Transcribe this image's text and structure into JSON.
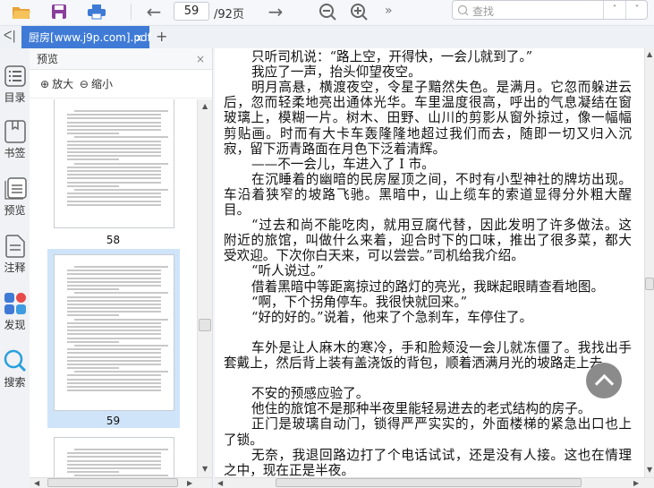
{
  "toolbar": {
    "current_page": "59",
    "total_pages": "/92页",
    "more": "»",
    "search_placeholder": "查找",
    "search_prev": "˄",
    "search_next": "˅"
  },
  "tabs": {
    "collapse": "ᐸ|",
    "active_tab": "厨房[www.j9p.com].pdf",
    "close": "x",
    "add": "+"
  },
  "rail": {
    "items": [
      {
        "label": "目录"
      },
      {
        "label": "书签"
      },
      {
        "label": "预览"
      },
      {
        "label": "注释"
      },
      {
        "label": "发现"
      },
      {
        "label": "搜索"
      }
    ]
  },
  "panel": {
    "title": "预览",
    "close": "×",
    "zoom_in": "放大",
    "zoom_out": "缩小",
    "pages": [
      "58",
      "59"
    ]
  },
  "document": {
    "lines": [
      {
        "t": "只听司机说：“路上空，开得快，一会儿就到了。”",
        "ind": true,
        "full": false
      },
      {
        "t": "我应了一声，抬头仰望夜空。",
        "ind": true,
        "full": false
      },
      {
        "t": "明月高悬，横渡夜空，令星子黯然失色。是满月。它忽而躲进云",
        "ind": true,
        "full": true
      },
      {
        "t": "后，忽而轻柔地亮出通体光华。车里温度很高，呼出的气息凝结在窗",
        "ind": false,
        "full": true
      },
      {
        "t": "玻璃上，模糊一片。树木、田野、山川的剪影从窗外掠过，像一幅幅",
        "ind": false,
        "full": true
      },
      {
        "t": "剪贴画。时而有大卡车轰隆隆地超过我们而去，随即一切又归入沉",
        "ind": false,
        "full": true
      },
      {
        "t": "寂，留下沥青路面在月色下泛着清辉。",
        "ind": false,
        "full": false
      },
      {
        "t": "——不一会儿，车进入了 I 市。",
        "ind": true,
        "full": false
      },
      {
        "t": "在沉睡着的幽暗的民房屋顶之间，不时有小型神社的牌坊出现。",
        "ind": true,
        "full": true
      },
      {
        "t": "车沿着狭窄的坡路飞驰。黑暗中，山上缆车的索道显得分外粗大醒",
        "ind": false,
        "full": true
      },
      {
        "t": "目。",
        "ind": false,
        "full": false
      },
      {
        "t": " “过去和尚不能吃肉，就用豆腐代替，因此发明了许多做法。这",
        "ind": true,
        "full": true
      },
      {
        "t": "附近的旅馆，叫做什么来着，迎合时下的口味，推出了很多菜，都大",
        "ind": false,
        "full": true
      },
      {
        "t": "受欢迎。下次你白天来，可以尝尝。”司机给我介绍。",
        "ind": false,
        "full": false
      },
      {
        "t": "“听人说过。”",
        "ind": true,
        "full": false
      },
      {
        "t": "借着黑暗中等距离掠过的路灯的亮光，我眯起眼睛查看地图。",
        "ind": true,
        "full": false
      },
      {
        "t": "“啊，下个拐角停车。我很快就回来。”",
        "ind": true,
        "full": false
      },
      {
        "t": "“好的好的。”说着，他来了个急刹车，车停住了。",
        "ind": true,
        "full": false
      },
      {
        "t": "",
        "ind": false,
        "full": false
      },
      {
        "t": "车外是让人麻木的寒冷，手和脸颊没一会儿就冻僵了。我找出手",
        "ind": true,
        "full": true
      },
      {
        "t": "套戴上，然后背上装有盖浇饭的背包，顺着洒满月光的坡路走上去。",
        "ind": false,
        "full": false
      },
      {
        "t": "",
        "ind": false,
        "full": false
      },
      {
        "t": "不安的预感应验了。",
        "ind": true,
        "full": false
      },
      {
        "t": "他住的旅馆不是那种半夜里能轻易进去的老式结构的房子。",
        "ind": true,
        "full": false
      },
      {
        "t": "正门是玻璃自动门，锁得严严实实的，外面楼梯的紧急出口也上",
        "ind": true,
        "full": true
      },
      {
        "t": "了锁。",
        "ind": false,
        "full": false
      },
      {
        "t": "无奈，我退回路边打了个电话试试，还是没有人接。这也在情理",
        "ind": true,
        "full": true
      },
      {
        "t": "之中，现在正是半夜。",
        "ind": false,
        "full": false
      }
    ]
  },
  "scrollbar_position": 0.55
}
